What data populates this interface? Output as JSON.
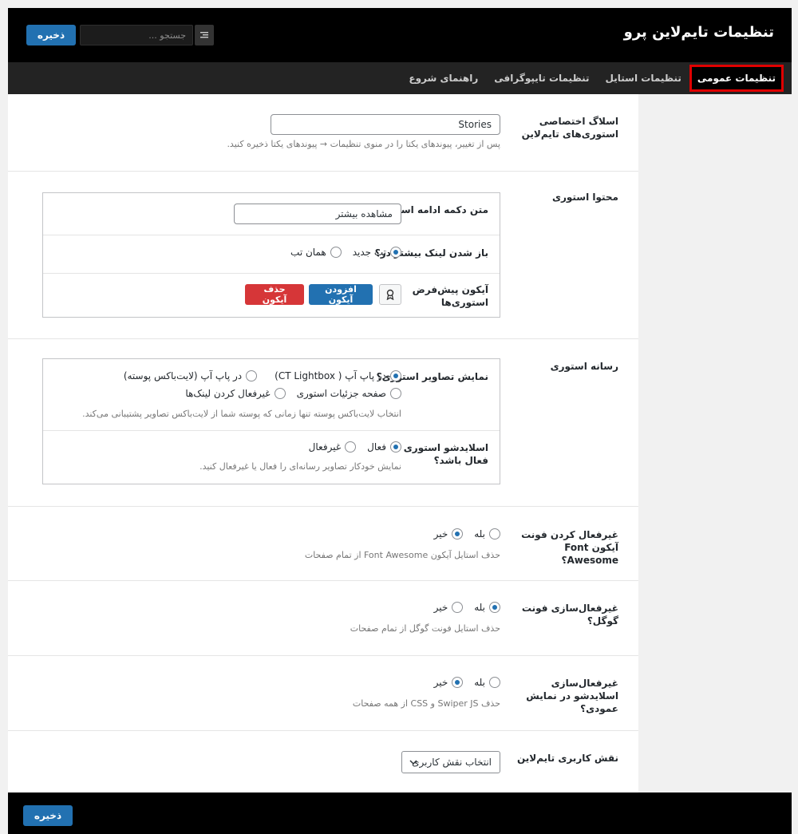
{
  "header": {
    "title": "تنظیمات تایم‌لاین پرو",
    "save_label": "ذخیره",
    "search_placeholder": "جستجو ..."
  },
  "tabs": [
    {
      "label": "تنظیمات عمومی",
      "active": true
    },
    {
      "label": "تنظیمات استایل",
      "active": false
    },
    {
      "label": "تنظیمات تایپوگرافی",
      "active": false
    },
    {
      "label": "راهنمای شروع",
      "active": false
    }
  ],
  "slug": {
    "label": "اسلاگ اختصاصی استوری‌های تایم‌لاین",
    "value": "Stories",
    "desc": "پس از تغییر، پیوندهای یکتا را در منوی تنظیمات → پیوندهای یکتا ذخیره کنید."
  },
  "content": {
    "label": "محتوا استوری",
    "read_more": {
      "label": "متن دکمه ادامه استوری",
      "value": "مشاهده بیشتر"
    },
    "link_target": {
      "label": "باز شدن لینک بیشتر در؟",
      "options": [
        {
          "label": "تب جدید",
          "checked": true
        },
        {
          "label": "همان تب",
          "checked": false
        }
      ]
    },
    "default_icon": {
      "label": "آیکون پیش‌فرض استوری‌ها",
      "add_label": "افزودن آیکون",
      "remove_label": "حذف آیکون"
    }
  },
  "media": {
    "label": "رسانه استوری",
    "images_display": {
      "label": "نمایش تصاویر استوری؟",
      "options": [
        {
          "label": "در پاپ آپ ( CT Lightbox)",
          "checked": true
        },
        {
          "label": "در پاپ آپ (لایت‌باکس پوسته)",
          "checked": false
        },
        {
          "label": "صفحه جزئیات استوری",
          "checked": false
        },
        {
          "label": "غیرفعال کردن لینک‌ها",
          "checked": false
        }
      ],
      "desc": "انتخاب لایت‌باکس پوسته تنها زمانی که پوسته شما از لایت‌باکس تصاویر پشتیبانی می‌کند."
    },
    "slideshow": {
      "label": "اسلایدشو استوری فعال باشد؟",
      "options": [
        {
          "label": "فعال",
          "checked": true
        },
        {
          "label": "غیرفعال",
          "checked": false
        }
      ],
      "desc": "نمایش خودکار تصاویر رسانه‌ای را فعال یا غیرفعال کنید."
    }
  },
  "font_awesome": {
    "label": "غیرفعال کردن فونت آیکون Font Awesome؟",
    "options": [
      {
        "label": "بله",
        "checked": false
      },
      {
        "label": "خیر",
        "checked": true
      }
    ],
    "desc": "حذف استایل آیکون Font Awesome از تمام صفحات"
  },
  "google_font": {
    "label": "غیرفعال‌سازی فونت گوگل؟",
    "options": [
      {
        "label": "بله",
        "checked": true
      },
      {
        "label": "خیر",
        "checked": false
      }
    ],
    "desc": "حذف استایل فونت گوگل از تمام صفحات"
  },
  "vertical_slideshow": {
    "label": "غیرفعال‌سازی اسلایدشو در نمایش عمودی؟",
    "options": [
      {
        "label": "بله",
        "checked": false
      },
      {
        "label": "خیر",
        "checked": true
      }
    ],
    "desc": "حذف Swiper JS و CSS از همه صفحات"
  },
  "user_role": {
    "label": "نقش کاربری تایم‌لاین",
    "selected": "انتخاب نقش کاربری"
  },
  "footer": {
    "save_label": "ذخیره"
  }
}
